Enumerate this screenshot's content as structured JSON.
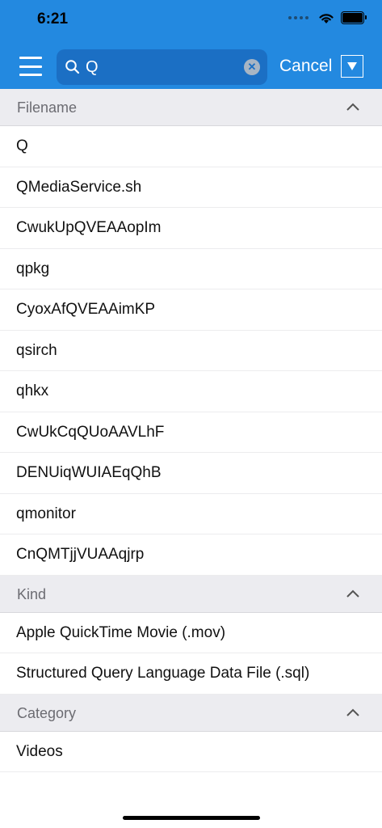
{
  "status_bar": {
    "time": "6:21"
  },
  "header": {
    "search": {
      "value": "Q",
      "placeholder": ""
    },
    "cancel_label": "Cancel"
  },
  "sections": {
    "filename": {
      "title": "Filename",
      "items": [
        "Q",
        "QMediaService.sh",
        "CwukUpQVEAAopIm",
        "qpkg",
        "CyoxAfQVEAAimKP",
        "qsirch",
        "qhkx",
        "CwUkCqQUoAAVLhF",
        "DENUiqWUIAEqQhB",
        "qmonitor",
        "CnQMTjjVUAAqjrp"
      ]
    },
    "kind": {
      "title": "Kind",
      "items": [
        "Apple QuickTime Movie (.mov)",
        "Structured Query Language Data File (.sql)"
      ]
    },
    "category": {
      "title": "Category",
      "items": [
        "Videos"
      ]
    }
  },
  "colors": {
    "header_bg": "#2389e0",
    "search_bg": "#1b6fc4",
    "section_bg": "#ececf0"
  }
}
